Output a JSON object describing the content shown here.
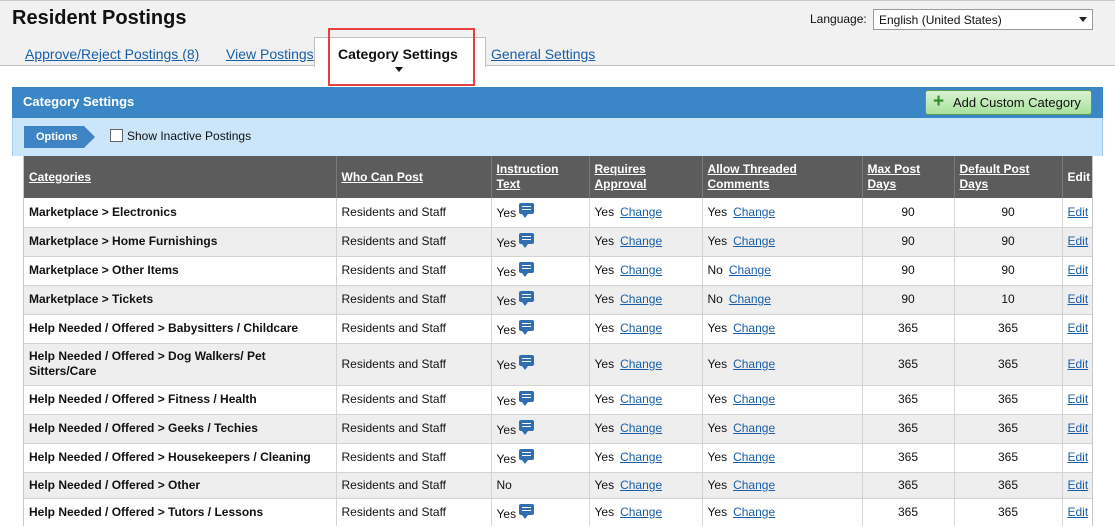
{
  "header": {
    "title": "Resident Postings",
    "language_label": "Language:",
    "language_value": "English (United States)"
  },
  "tabs": {
    "approve": "Approve/Reject Postings (8)",
    "view": "View Postings",
    "category": "Category Settings",
    "general": "General Settings"
  },
  "panel": {
    "title": "Category Settings",
    "add_button": "Add Custom Category",
    "options_label": "Options",
    "show_inactive_label": "Show Inactive Postings"
  },
  "table": {
    "headers": {
      "categories": "Categories",
      "who": "Who Can Post",
      "instruction": "Instruction Text",
      "requires": "Requires Approval",
      "threaded": "Allow Threaded Comments",
      "max": "Max Post Days",
      "default": "Default Post Days",
      "edit": "Edit"
    },
    "change_label": "Change",
    "edit_label": "Edit",
    "rows": [
      {
        "category": "Marketplace > Electronics",
        "who": "Residents and Staff",
        "instruction": "Yes",
        "has_text": true,
        "requires": "Yes",
        "threaded": "Yes",
        "max": "90",
        "default": "90"
      },
      {
        "category": "Marketplace > Home Furnishings",
        "who": "Residents and Staff",
        "instruction": "Yes",
        "has_text": true,
        "requires": "Yes",
        "threaded": "Yes",
        "max": "90",
        "default": "90"
      },
      {
        "category": "Marketplace > Other Items",
        "who": "Residents and Staff",
        "instruction": "Yes",
        "has_text": true,
        "requires": "Yes",
        "threaded": "No",
        "max": "90",
        "default": "90"
      },
      {
        "category": "Marketplace > Tickets",
        "who": "Residents and Staff",
        "instruction": "Yes",
        "has_text": true,
        "requires": "Yes",
        "threaded": "No",
        "max": "90",
        "default": "10"
      },
      {
        "category": "Help Needed / Offered > Babysitters / Childcare",
        "who": "Residents and Staff",
        "instruction": "Yes",
        "has_text": true,
        "requires": "Yes",
        "threaded": "Yes",
        "max": "365",
        "default": "365"
      },
      {
        "category": "Help Needed / Offered > Dog Walkers/ Pet Sitters/Care",
        "who": "Residents and Staff",
        "instruction": "Yes",
        "has_text": true,
        "requires": "Yes",
        "threaded": "Yes",
        "max": "365",
        "default": "365"
      },
      {
        "category": "Help Needed / Offered > Fitness / Health",
        "who": "Residents and Staff",
        "instruction": "Yes",
        "has_text": true,
        "requires": "Yes",
        "threaded": "Yes",
        "max": "365",
        "default": "365"
      },
      {
        "category": "Help Needed / Offered > Geeks / Techies",
        "who": "Residents and Staff",
        "instruction": "Yes",
        "has_text": true,
        "requires": "Yes",
        "threaded": "Yes",
        "max": "365",
        "default": "365"
      },
      {
        "category": "Help Needed / Offered > Housekeepers / Cleaning",
        "who": "Residents and Staff",
        "instruction": "Yes",
        "has_text": true,
        "requires": "Yes",
        "threaded": "Yes",
        "max": "365",
        "default": "365"
      },
      {
        "category": "Help Needed / Offered > Other",
        "who": "Residents and Staff",
        "instruction": "No",
        "has_text": false,
        "requires": "Yes",
        "threaded": "Yes",
        "max": "365",
        "default": "365"
      },
      {
        "category": "Help Needed / Offered > Tutors / Lessons",
        "who": "Residents and Staff",
        "instruction": "Yes",
        "has_text": true,
        "requires": "Yes",
        "threaded": "Yes",
        "max": "365",
        "default": "365"
      }
    ]
  }
}
